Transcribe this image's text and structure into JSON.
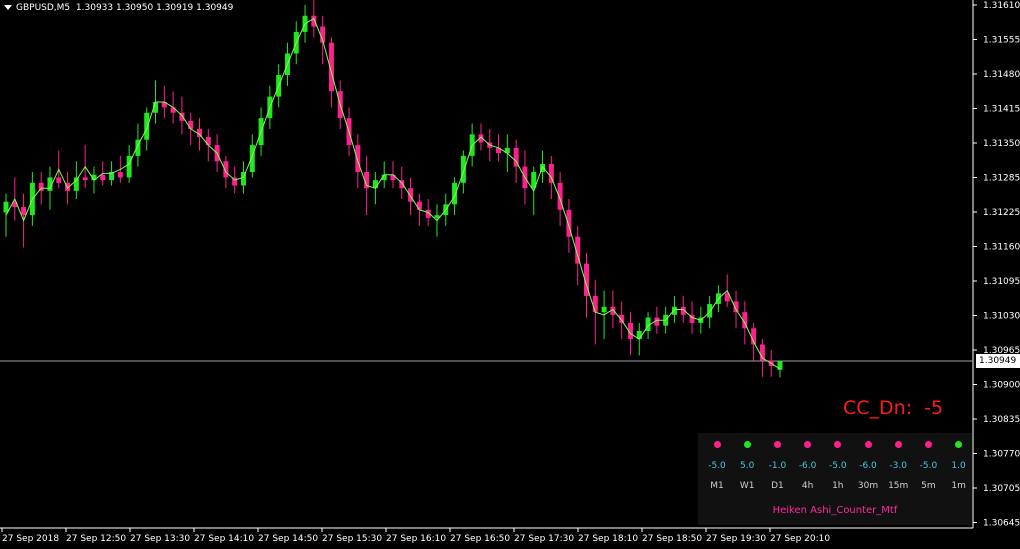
{
  "header": {
    "symbol": "GBPUSD,M5",
    "ohlc": "1.30933 1.30950 1.30919 1.30949"
  },
  "price_axis": {
    "ticks": [
      "1.31610",
      "1.31555",
      "1.31480",
      "1.31415",
      "1.31350",
      "1.31285",
      "1.31225",
      "1.31160",
      "1.31095",
      "1.31030",
      "1.30965",
      "1.30900",
      "1.30835",
      "1.30770",
      "1.30705",
      "1.30645"
    ],
    "current_price": "1.30949"
  },
  "time_axis": {
    "labels": [
      "27 Sep 2018",
      "27 Sep 12:50",
      "27 Sep 13:30",
      "27 Sep 14:10",
      "27 Sep 14:50",
      "27 Sep 15:30",
      "27 Sep 16:10",
      "27 Sep 16:50",
      "27 Sep 17:30",
      "27 Sep 18:10",
      "27 Sep 18:50",
      "27 Sep 19:30",
      "27 Sep 20:10"
    ]
  },
  "indicator": {
    "cc_label": "CC_Dn:  -5",
    "title": "Heiken Ashi_Counter_Mtf",
    "columns": [
      {
        "tf": "M1",
        "value": "-5.0",
        "state": "dn"
      },
      {
        "tf": "W1",
        "value": "5.0",
        "state": "up"
      },
      {
        "tf": "D1",
        "value": "-1.0",
        "state": "dn"
      },
      {
        "tf": "4h",
        "value": "-6.0",
        "state": "dn"
      },
      {
        "tf": "1h",
        "value": "-5.0",
        "state": "dn"
      },
      {
        "tf": "30m",
        "value": "-6.0",
        "state": "dn"
      },
      {
        "tf": "15m",
        "value": "-3.0",
        "state": "dn"
      },
      {
        "tf": "5m",
        "value": "-5.0",
        "state": "dn"
      },
      {
        "tf": "1m",
        "value": "1.0",
        "state": "up"
      }
    ]
  },
  "colors": {
    "up": "#22e622",
    "down": "#ff1f8f",
    "line": "#7cff4a",
    "value_text": "#44c8e0",
    "cc_text": "#ff1a1a"
  },
  "chart_data": {
    "type": "candlestick",
    "bull_color": "#22e622",
    "bear_color": "#ff1f8f",
    "ohlc": [
      {
        "o": 1.31225,
        "h": 1.3126,
        "l": 1.3118,
        "c": 1.31245
      },
      {
        "o": 1.31245,
        "h": 1.3129,
        "l": 1.3121,
        "c": 1.31235
      },
      {
        "o": 1.31235,
        "h": 1.3126,
        "l": 1.3116,
        "c": 1.3122
      },
      {
        "o": 1.3122,
        "h": 1.313,
        "l": 1.312,
        "c": 1.3128
      },
      {
        "o": 1.3128,
        "h": 1.313,
        "l": 1.3124,
        "c": 1.31265
      },
      {
        "o": 1.31265,
        "h": 1.3131,
        "l": 1.3123,
        "c": 1.3129
      },
      {
        "o": 1.3129,
        "h": 1.3134,
        "l": 1.3127,
        "c": 1.3128
      },
      {
        "o": 1.3128,
        "h": 1.313,
        "l": 1.3124,
        "c": 1.31265
      },
      {
        "o": 1.31265,
        "h": 1.3132,
        "l": 1.3125,
        "c": 1.3129
      },
      {
        "o": 1.3129,
        "h": 1.3135,
        "l": 1.3127,
        "c": 1.31285
      },
      {
        "o": 1.31285,
        "h": 1.3131,
        "l": 1.3126,
        "c": 1.31295
      },
      {
        "o": 1.31295,
        "h": 1.3132,
        "l": 1.31275,
        "c": 1.31285
      },
      {
        "o": 1.31285,
        "h": 1.3132,
        "l": 1.31275,
        "c": 1.313
      },
      {
        "o": 1.313,
        "h": 1.3133,
        "l": 1.3128,
        "c": 1.3129
      },
      {
        "o": 1.3129,
        "h": 1.3135,
        "l": 1.3128,
        "c": 1.3133
      },
      {
        "o": 1.3133,
        "h": 1.3139,
        "l": 1.3131,
        "c": 1.3136
      },
      {
        "o": 1.3136,
        "h": 1.3142,
        "l": 1.3134,
        "c": 1.3141
      },
      {
        "o": 1.3141,
        "h": 1.3147,
        "l": 1.3139,
        "c": 1.3143
      },
      {
        "o": 1.3143,
        "h": 1.3146,
        "l": 1.314,
        "c": 1.3142
      },
      {
        "o": 1.3142,
        "h": 1.3145,
        "l": 1.3139,
        "c": 1.3141
      },
      {
        "o": 1.3141,
        "h": 1.3144,
        "l": 1.3137,
        "c": 1.31395
      },
      {
        "o": 1.31395,
        "h": 1.3141,
        "l": 1.3135,
        "c": 1.3138
      },
      {
        "o": 1.3138,
        "h": 1.314,
        "l": 1.3134,
        "c": 1.31365
      },
      {
        "o": 1.31365,
        "h": 1.3138,
        "l": 1.3132,
        "c": 1.3135
      },
      {
        "o": 1.3135,
        "h": 1.3137,
        "l": 1.313,
        "c": 1.3132
      },
      {
        "o": 1.3132,
        "h": 1.3133,
        "l": 1.3127,
        "c": 1.3129
      },
      {
        "o": 1.3129,
        "h": 1.3131,
        "l": 1.3126,
        "c": 1.31275
      },
      {
        "o": 1.31275,
        "h": 1.3132,
        "l": 1.3126,
        "c": 1.313
      },
      {
        "o": 1.313,
        "h": 1.3137,
        "l": 1.3129,
        "c": 1.3135
      },
      {
        "o": 1.3135,
        "h": 1.3142,
        "l": 1.3133,
        "c": 1.314
      },
      {
        "o": 1.314,
        "h": 1.3146,
        "l": 1.3138,
        "c": 1.3144
      },
      {
        "o": 1.3144,
        "h": 1.315,
        "l": 1.3142,
        "c": 1.3148
      },
      {
        "o": 1.3148,
        "h": 1.3154,
        "l": 1.3146,
        "c": 1.3152
      },
      {
        "o": 1.3152,
        "h": 1.3158,
        "l": 1.315,
        "c": 1.3156
      },
      {
        "o": 1.3156,
        "h": 1.3161,
        "l": 1.3154,
        "c": 1.3159
      },
      {
        "o": 1.3159,
        "h": 1.3162,
        "l": 1.3155,
        "c": 1.3157
      },
      {
        "o": 1.3157,
        "h": 1.3159,
        "l": 1.315,
        "c": 1.3154
      },
      {
        "o": 1.3154,
        "h": 1.3155,
        "l": 1.3142,
        "c": 1.3145
      },
      {
        "o": 1.3145,
        "h": 1.3147,
        "l": 1.3138,
        "c": 1.314
      },
      {
        "o": 1.314,
        "h": 1.3142,
        "l": 1.3133,
        "c": 1.3135
      },
      {
        "o": 1.3135,
        "h": 1.3137,
        "l": 1.3127,
        "c": 1.313
      },
      {
        "o": 1.313,
        "h": 1.3133,
        "l": 1.3122,
        "c": 1.3127
      },
      {
        "o": 1.3127,
        "h": 1.313,
        "l": 1.3124,
        "c": 1.31285
      },
      {
        "o": 1.31285,
        "h": 1.3132,
        "l": 1.3127,
        "c": 1.31295
      },
      {
        "o": 1.31295,
        "h": 1.3132,
        "l": 1.3127,
        "c": 1.31285
      },
      {
        "o": 1.31285,
        "h": 1.3131,
        "l": 1.3125,
        "c": 1.3127
      },
      {
        "o": 1.3127,
        "h": 1.3129,
        "l": 1.3122,
        "c": 1.31245
      },
      {
        "o": 1.31245,
        "h": 1.3126,
        "l": 1.312,
        "c": 1.3123
      },
      {
        "o": 1.3123,
        "h": 1.3125,
        "l": 1.312,
        "c": 1.31215
      },
      {
        "o": 1.31215,
        "h": 1.3124,
        "l": 1.3118,
        "c": 1.3122
      },
      {
        "o": 1.3122,
        "h": 1.3126,
        "l": 1.312,
        "c": 1.3124
      },
      {
        "o": 1.3124,
        "h": 1.3129,
        "l": 1.3122,
        "c": 1.3128
      },
      {
        "o": 1.3128,
        "h": 1.3134,
        "l": 1.3126,
        "c": 1.3133
      },
      {
        "o": 1.3133,
        "h": 1.3139,
        "l": 1.3131,
        "c": 1.3137
      },
      {
        "o": 1.3137,
        "h": 1.3139,
        "l": 1.3134,
        "c": 1.31355
      },
      {
        "o": 1.31355,
        "h": 1.3138,
        "l": 1.3132,
        "c": 1.31345
      },
      {
        "o": 1.31345,
        "h": 1.3137,
        "l": 1.3132,
        "c": 1.31335
      },
      {
        "o": 1.31335,
        "h": 1.3137,
        "l": 1.313,
        "c": 1.31345
      },
      {
        "o": 1.31345,
        "h": 1.3136,
        "l": 1.3128,
        "c": 1.3131
      },
      {
        "o": 1.3131,
        "h": 1.3134,
        "l": 1.3124,
        "c": 1.3127
      },
      {
        "o": 1.3127,
        "h": 1.3131,
        "l": 1.3122,
        "c": 1.313
      },
      {
        "o": 1.313,
        "h": 1.3134,
        "l": 1.3128,
        "c": 1.31315
      },
      {
        "o": 1.31315,
        "h": 1.3133,
        "l": 1.3125,
        "c": 1.3128
      },
      {
        "o": 1.3128,
        "h": 1.313,
        "l": 1.312,
        "c": 1.3123
      },
      {
        "o": 1.3123,
        "h": 1.3125,
        "l": 1.3115,
        "c": 1.3118
      },
      {
        "o": 1.3118,
        "h": 1.312,
        "l": 1.3109,
        "c": 1.3113
      },
      {
        "o": 1.3113,
        "h": 1.3115,
        "l": 1.3103,
        "c": 1.3107
      },
      {
        "o": 1.3107,
        "h": 1.311,
        "l": 1.3098,
        "c": 1.3104
      },
      {
        "o": 1.3104,
        "h": 1.3108,
        "l": 1.3099,
        "c": 1.3105
      },
      {
        "o": 1.3105,
        "h": 1.3108,
        "l": 1.3101,
        "c": 1.31035
      },
      {
        "o": 1.31035,
        "h": 1.3106,
        "l": 1.3099,
        "c": 1.3102
      },
      {
        "o": 1.3102,
        "h": 1.3104,
        "l": 1.3096,
        "c": 1.3099
      },
      {
        "o": 1.3099,
        "h": 1.3102,
        "l": 1.3096,
        "c": 1.31005
      },
      {
        "o": 1.31005,
        "h": 1.3104,
        "l": 1.3099,
        "c": 1.3103
      },
      {
        "o": 1.3103,
        "h": 1.3105,
        "l": 1.31,
        "c": 1.31015
      },
      {
        "o": 1.31015,
        "h": 1.3105,
        "l": 1.31,
        "c": 1.31035
      },
      {
        "o": 1.31035,
        "h": 1.3107,
        "l": 1.3102,
        "c": 1.3105
      },
      {
        "o": 1.3105,
        "h": 1.3107,
        "l": 1.3102,
        "c": 1.31035
      },
      {
        "o": 1.31035,
        "h": 1.3106,
        "l": 1.31,
        "c": 1.3102
      },
      {
        "o": 1.3102,
        "h": 1.3105,
        "l": 1.31,
        "c": 1.3103
      },
      {
        "o": 1.3103,
        "h": 1.3107,
        "l": 1.3101,
        "c": 1.31055
      },
      {
        "o": 1.31055,
        "h": 1.3109,
        "l": 1.3104,
        "c": 1.31075
      },
      {
        "o": 1.31075,
        "h": 1.3111,
        "l": 1.3105,
        "c": 1.3106
      },
      {
        "o": 1.3106,
        "h": 1.3108,
        "l": 1.3101,
        "c": 1.3104
      },
      {
        "o": 1.3104,
        "h": 1.3106,
        "l": 1.3098,
        "c": 1.3101
      },
      {
        "o": 1.3101,
        "h": 1.3102,
        "l": 1.3095,
        "c": 1.3098
      },
      {
        "o": 1.3098,
        "h": 1.3099,
        "l": 1.3092,
        "c": 1.3095
      },
      {
        "o": 1.3095,
        "h": 1.3097,
        "l": 1.3092,
        "c": 1.3094
      },
      {
        "o": 1.30933,
        "h": 1.3095,
        "l": 1.30919,
        "c": 1.30949
      }
    ]
  }
}
